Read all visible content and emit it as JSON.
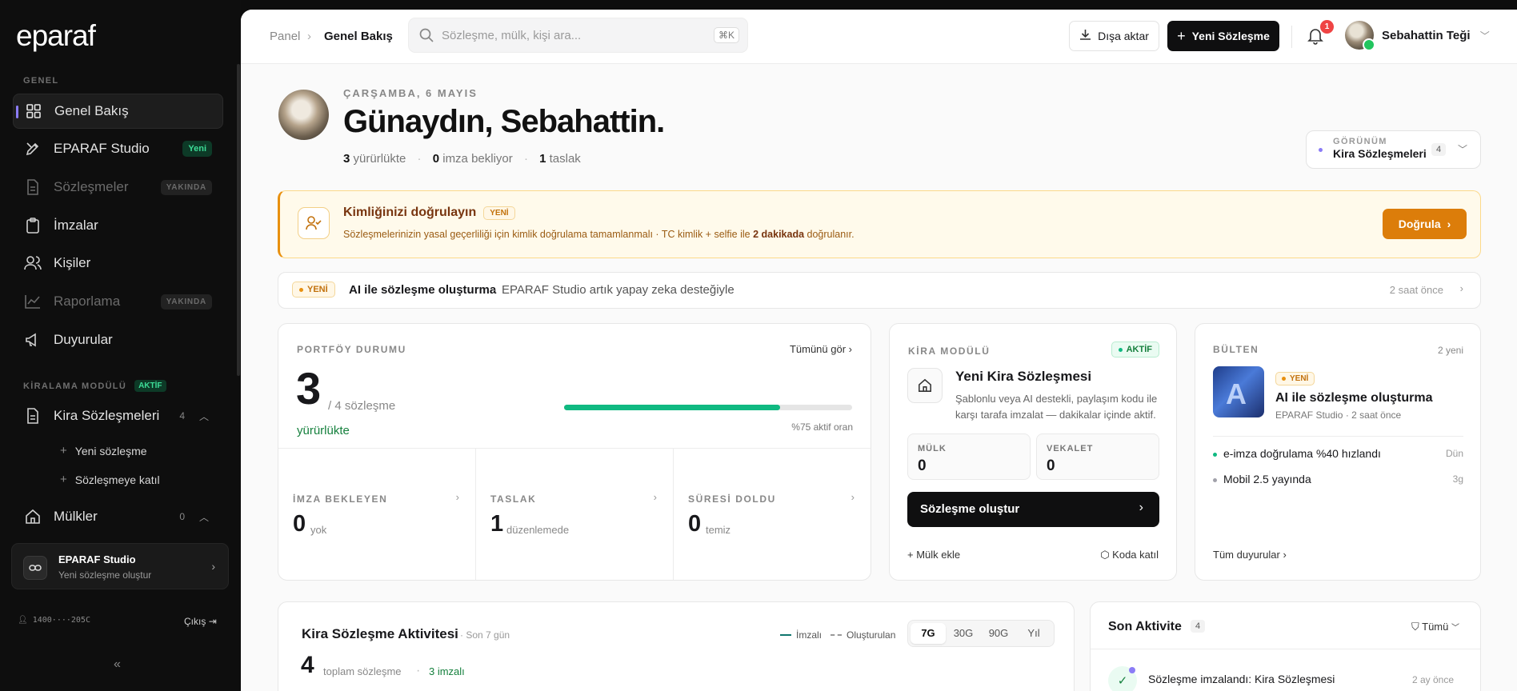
{
  "sidebar": {
    "logo": "eparaf",
    "section_general": "GENEL",
    "nav": [
      {
        "label": "Genel Bakış"
      },
      {
        "label": "EPARAF Studio",
        "badge": "Yeni"
      },
      {
        "label": "Sözleşmeler",
        "badge": "YAKINDA"
      },
      {
        "label": "İmzalar"
      },
      {
        "label": "Kişiler"
      },
      {
        "label": "Raporlama",
        "badge": "YAKINDA"
      },
      {
        "label": "Duyurular"
      }
    ],
    "section_rental": "KİRALAMA MODÜLÜ",
    "section_rental_badge": "AKTİF",
    "rental": {
      "label": "Kira Sözleşmeleri",
      "count": "4"
    },
    "rental_sub": [
      {
        "label": "Yeni sözleşme"
      },
      {
        "label": "Sözleşmeye katıl"
      }
    ],
    "properties": {
      "label": "Mülkler",
      "count": "0"
    },
    "studio_card": {
      "title": "EPARAF Studio",
      "subtitle": "Yeni sözleşme oluştur"
    },
    "user_id": "1400····205C",
    "logout": "Çıkış"
  },
  "topbar": {
    "crumb_root": "Panel",
    "crumb_current": "Genel Bakış",
    "search_placeholder": "Sözleşme, mülk, kişi ara...",
    "search_shortcut": "⌘K",
    "export_label": "Dışa aktar",
    "new_contract_label": "Yeni Sözleşme",
    "notif_count": "1",
    "user_name": "Sebahattin Teği"
  },
  "hero": {
    "date": "ÇARŞAMBA, 6 MAYIS",
    "greeting": "Günaydın, Sebahattin.",
    "active_num": "3",
    "active_txt": "yürürlükte",
    "pending_num": "0",
    "pending_txt": "imza bekliyor",
    "draft_num": "1",
    "draft_txt": "taslak",
    "view_label": "GÖRÜNÜM",
    "view_value": "Kira Sözleşmeleri",
    "view_count": "4"
  },
  "verify": {
    "title": "Kimliğinizi doğrulayın",
    "badge": "YENİ",
    "desc_before": "Sözleşmelerinizin yasal geçerliliği için kimlik doğrulama tamamlanmalı · TC kimlik + selfie ile",
    "desc_bold": "2 dakikada",
    "desc_after": "doğrulanır.",
    "button": "Doğrula"
  },
  "news": {
    "badge": "YENİ",
    "title": "AI ile sözleşme oluşturma",
    "sep": "·",
    "desc": "EPARAF Studio artık yapay zeka desteğiyle",
    "time": "2 saat önce"
  },
  "portfolio": {
    "label": "PORTFÖY DURUMU",
    "see_all": "Tümünü gör",
    "big": "3",
    "of": "/ 4 sözleşme",
    "status": "yürürlükte",
    "progress": 0.75,
    "rate": "%75 aktif oran",
    "cells": [
      {
        "label": "İMZA BEKLEYEN",
        "value": "0",
        "note": "yok"
      },
      {
        "label": "TASLAK",
        "value": "1",
        "note": "düzenlemede"
      },
      {
        "label": "SÜRESİ DOLDU",
        "value": "0",
        "note": "temiz"
      }
    ]
  },
  "rental_module": {
    "label": "KİRA MODÜLÜ",
    "badge": "AKTİF",
    "title": "Yeni Kira Sözleşmesi",
    "desc": "Şablonlu veya AI destekli, paylaşım kodu ile karşı tarafa imzalat — dakikalar içinde aktif.",
    "property_label": "MÜLK",
    "property_value": "0",
    "agent_label": "VEKALET",
    "agent_value": "0",
    "create": "Sözleşme oluştur",
    "add_property": "Mülk ekle",
    "join_code": "Koda katıl"
  },
  "bulletin": {
    "label": "BÜLTEN",
    "count": "2 yeni",
    "badge": "YENİ",
    "feature_title": "AI ile sözleşme oluşturma",
    "feature_meta": "EPARAF Studio · 2 saat önce",
    "items": [
      {
        "text": "e-imza doğrulama %40 hızlandı",
        "time": "Dün",
        "color": "#10b981"
      },
      {
        "text": "Mobil 2.5 yayında",
        "time": "3g",
        "color": "#a1a1aa"
      }
    ],
    "all": "Tüm duyurular"
  },
  "activity": {
    "title": "Kira Sözleşme Aktivitesi",
    "period": "· Son 7 gün",
    "legend_signed": "İmzalı",
    "legend_created": "Oluşturulan",
    "tabs": [
      "7G",
      "30G",
      "90G",
      "Yıl"
    ],
    "total": "4",
    "total_txt": "toplam sözleşme",
    "signed": "3 imzalı"
  },
  "recent": {
    "title": "Son Aktivite",
    "count": "4",
    "filter": "Tümü",
    "item_title": "Sözleşme imzalandı: Kira Sözleşmesi",
    "item_time": "2 ay önce"
  },
  "colors": {
    "accent": "#8b7cf6",
    "success": "#10b981",
    "warning": "#e8900f"
  }
}
